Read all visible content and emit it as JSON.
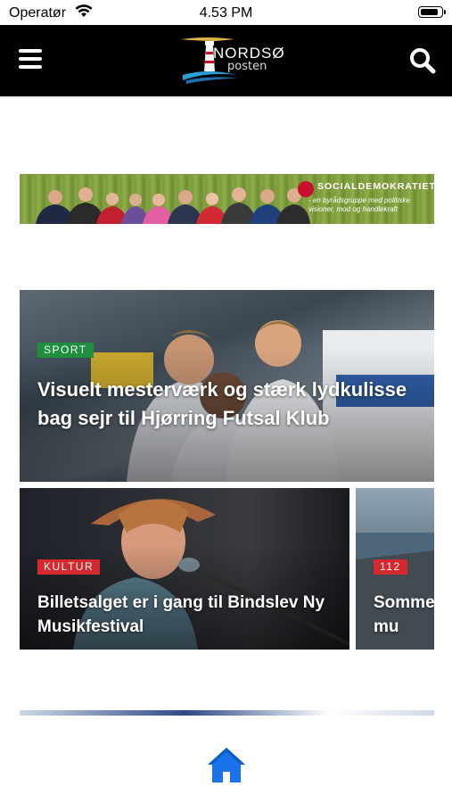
{
  "status_bar": {
    "carrier": "Operatør",
    "time": "4.53 PM",
    "battery_level": 0.9
  },
  "header": {
    "logo": {
      "word": "NORDSØ",
      "sub": "posten"
    },
    "menu_icon": "hamburger-icon",
    "search_icon": "search-icon"
  },
  "ad": {
    "brand": "SOCIALDEMOKRATIET",
    "tagline": "- en byrådsgruppe med politiske visioner, mod og handlekraft"
  },
  "articles": [
    {
      "category": "SPORT",
      "category_color": "#1e8f3e",
      "title": "Visuelt mesterværk og stærk lydkulisse bag sejr til Hjørring Futsal Klub"
    },
    {
      "category": "KULTUR",
      "category_color": "#d6282f",
      "title": "Billetsalget er i gang til Bindslev Ny Musikfestival"
    },
    {
      "category": "112",
      "category_color": "#d6282f",
      "title": "Somme kommu"
    }
  ],
  "colors": {
    "header_bg": "#000000",
    "home_icon": "#1a73e8"
  },
  "tabbar": {
    "home_icon": "home-icon"
  }
}
